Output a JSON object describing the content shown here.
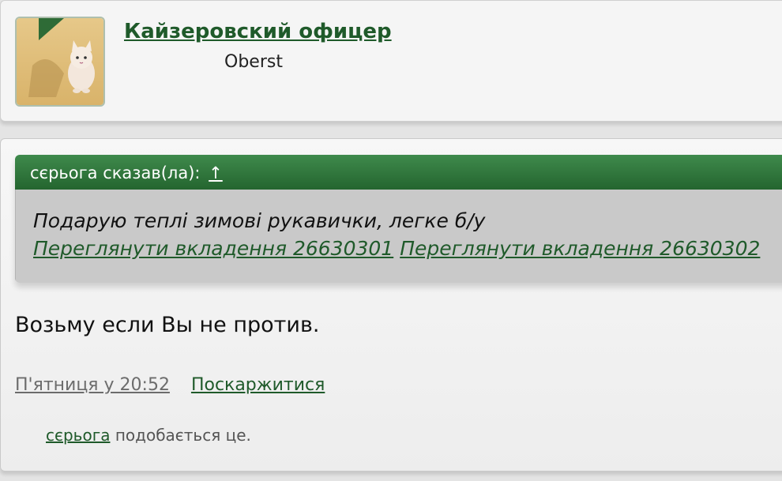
{
  "user": {
    "name": "Кайзеровский офицер",
    "title": "Oberst",
    "avatar_icon": "cat-avatar-icon"
  },
  "quote": {
    "author_line": "сєрьога сказав(ла):",
    "jump_arrow": "↑",
    "text": "Подарую теплі зимові рукавички, легке б/у",
    "attachments": [
      "Переглянути вкладення 26630301",
      "Переглянути вкладення 26630302"
    ]
  },
  "post": {
    "message": "Возьму если Вы не против.",
    "date": "П'ятниця у 20:52",
    "report_label": "Поскаржитися",
    "likes": {
      "liker": "сєрьога",
      "suffix": " подобається це."
    }
  },
  "colors": {
    "accent_green": "#24652f",
    "link_green": "#1f5a2a",
    "quote_bg": "#c9c9c9"
  }
}
